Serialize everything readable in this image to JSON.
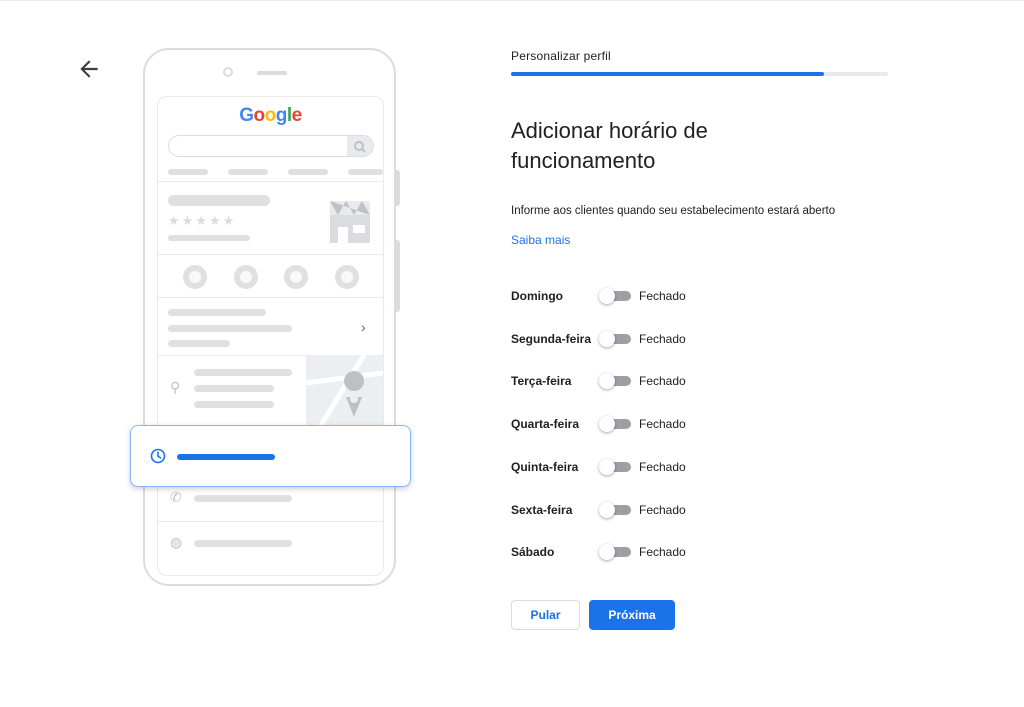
{
  "nav": {
    "back_icon": "arrow-back-icon"
  },
  "illustration": {
    "logo_text": "Google",
    "logo_letters": [
      {
        "ch": "G",
        "color": "#4285f4"
      },
      {
        "ch": "o",
        "color": "#ea4335"
      },
      {
        "ch": "o",
        "color": "#fbbc05"
      },
      {
        "ch": "g",
        "color": "#4285f4"
      },
      {
        "ch": "l",
        "color": "#34a853"
      },
      {
        "ch": "e",
        "color": "#ea4335"
      }
    ],
    "stars": "★★★★★",
    "chevron": "›",
    "icons": [
      "phone-icon",
      "directions-icon",
      "save-icon",
      "website-icon",
      "location-icon",
      "clock-icon",
      "phone-icon",
      "globe-icon"
    ]
  },
  "step": {
    "label": "Personalizar perfil",
    "progress": 0.83
  },
  "title": "Adicionar horário de funcionamento",
  "description": "Informe aos clientes quando seu estabelecimento estará aberto",
  "learn_more": "Saiba mais",
  "days": [
    {
      "name": "Domingo",
      "status": "Fechado",
      "open": false
    },
    {
      "name": "Segunda-feira",
      "status": "Fechado",
      "open": false
    },
    {
      "name": "Terça-feira",
      "status": "Fechado",
      "open": false
    },
    {
      "name": "Quarta-feira",
      "status": "Fechado",
      "open": false
    },
    {
      "name": "Quinta-feira",
      "status": "Fechado",
      "open": false
    },
    {
      "name": "Sexta-feira",
      "status": "Fechado",
      "open": false
    },
    {
      "name": "Sábado",
      "status": "Fechado",
      "open": false
    }
  ],
  "actions": {
    "skip": "Pular",
    "next": "Próxima"
  },
  "colors": {
    "accent": "#1a73e8",
    "toggle_off": "#9aa0a6"
  }
}
